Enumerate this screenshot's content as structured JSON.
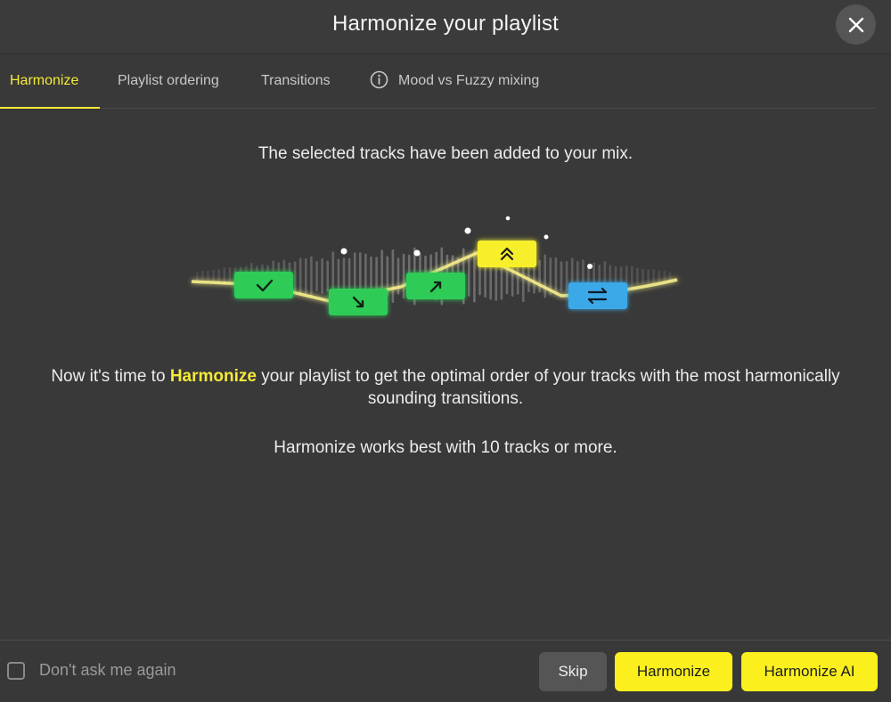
{
  "dialog": {
    "title": "Harmonize your playlist",
    "close_icon": "close-icon"
  },
  "tabs": [
    {
      "label": "Harmonize",
      "active": true
    },
    {
      "label": "Playlist ordering",
      "active": false
    },
    {
      "label": "Transitions",
      "active": false
    },
    {
      "label": "Mood vs Fuzzy mixing",
      "active": false,
      "icon": "info-icon"
    }
  ],
  "content": {
    "lead": "The selected tracks have been added to your mix.",
    "para_before": "Now it's time to ",
    "para_highlight": "Harmonize",
    "para_after": " your playlist to get the optimal order of your tracks with the most harmonically sounding transitions.",
    "para2": "Harmonize works best with 10 tracks or more."
  },
  "illustration": {
    "nodes": [
      {
        "icon": "check-icon",
        "color": "#2ecc56"
      },
      {
        "icon": "arrow-down-right-icon",
        "color": "#2ecc56"
      },
      {
        "icon": "arrow-up-right-icon",
        "color": "#2ecc56"
      },
      {
        "icon": "double-chevron-up-icon",
        "color": "#f7ef2a"
      },
      {
        "icon": "swap-arrows-icon",
        "color": "#3aa8e8"
      }
    ]
  },
  "footer": {
    "checkbox_label": "Don't ask me again",
    "checkbox_checked": false,
    "skip_label": "Skip",
    "harmonize_label": "Harmonize",
    "harmonize_ai_label": "Harmonize AI"
  },
  "colors": {
    "accent": "#f5ea37",
    "background": "#393939"
  }
}
